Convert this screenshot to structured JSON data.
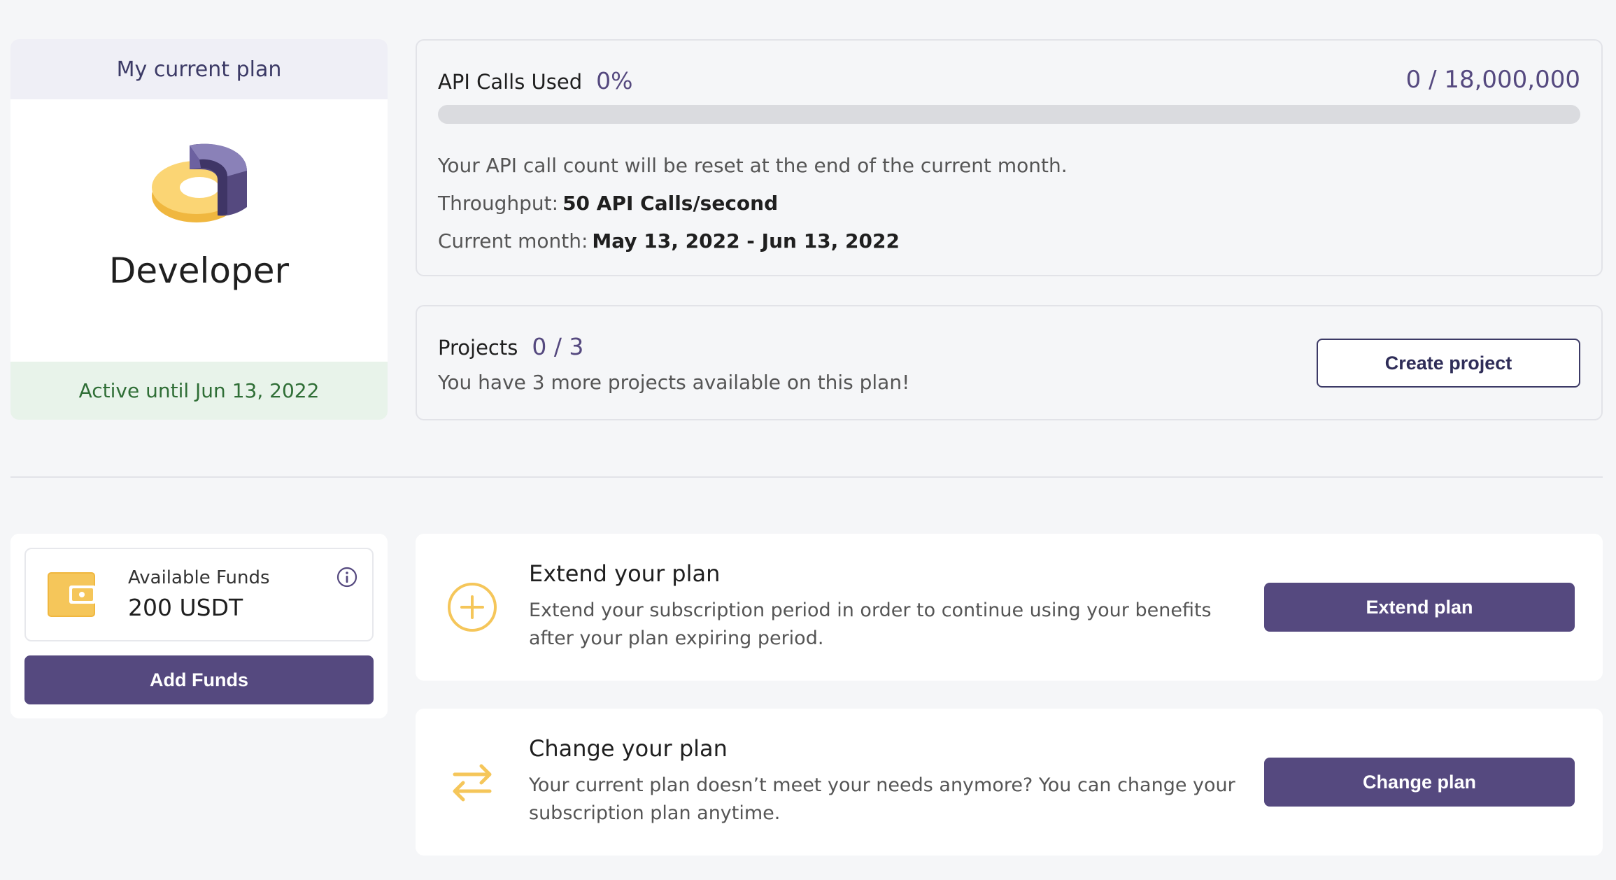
{
  "plan": {
    "header": "My current plan",
    "name": "Developer",
    "active_until": "Active until Jun 13, 2022",
    "logo_colors": {
      "purple": "#55497f",
      "purple_light": "#7b71a8",
      "yellow": "#f5c65a",
      "yellow_light": "#fde8a8"
    }
  },
  "api": {
    "title": "API Calls Used",
    "percent": "0%",
    "used_fraction": 0,
    "count": "0 / 18,000,000",
    "reset_note": "Your API call count will be reset at the end of the current month.",
    "throughput_label": "Throughput:",
    "throughput_value": "50 API Calls/second",
    "month_label": "Current month:",
    "month_value": "May 13, 2022 - Jun 13, 2022"
  },
  "projects": {
    "title": "Projects",
    "count": "0 / 3",
    "description": "You have 3 more projects available on this plan!",
    "create_button": "Create project"
  },
  "funds": {
    "label": "Available Funds",
    "value": "200 USDT",
    "add_button": "Add Funds",
    "icon": "wallet-icon",
    "info_icon": "info-icon"
  },
  "extend": {
    "title": "Extend your plan",
    "description": "Extend your subscription period in order to continue using your benefits after your plan expiring period.",
    "button": "Extend plan",
    "icon": "plus-circle-icon"
  },
  "change": {
    "title": "Change your plan",
    "description": "Your current plan doesn’t meet your needs anymore? You can change your subscription plan anytime.",
    "button": "Change plan",
    "icon": "swap-arrows-icon"
  },
  "colors": {
    "accent": "#55497f",
    "icon_yellow": "#f5c65a",
    "active_green": "#2f6e36",
    "active_bg": "#e8f3ea"
  }
}
